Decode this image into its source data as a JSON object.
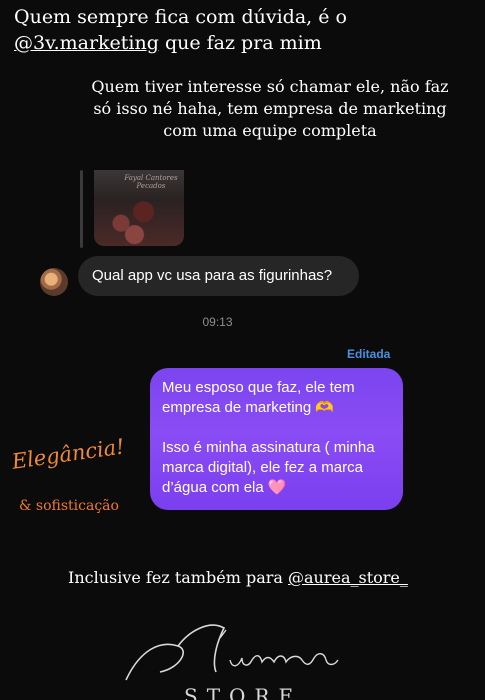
{
  "captions": {
    "line1_before": "Quem sempre fica com dúvida, é o",
    "mention1": "@3v.marketing",
    "line2_after": " que faz pra mim",
    "paragraph": "Quem tiver interesse só chamar ele, não faz só isso né haha, tem empresa de marketing com uma equipe completa",
    "bottom_before": "Inclusive fez também para ",
    "mention2": "@aurea_store_"
  },
  "reply_thumbnail": {
    "overlay_text": "Fayal Cantores Pecados"
  },
  "incoming": {
    "text": "Qual app vc usa para as figurinhas?"
  },
  "timestamp": "09:13",
  "edited_label": "Editada",
  "outgoing": {
    "paragraph1": "Meu esposo que faz, ele tem empresa de marketing 🫶",
    "paragraph2": "Isso é minha assinatura ( minha marca digital), ele fez a marca d’água com ela 🩷"
  },
  "stickers": {
    "elegancia": "Elegância!",
    "sofisticacao": "& sofisticação"
  },
  "logo": {
    "script": "Aurea",
    "store": "STORE"
  },
  "colors": {
    "background": "#0b0b0b",
    "incoming_bubble": "#262626",
    "outgoing_bubble": "#8a4cf4",
    "edited": "#4a90e2",
    "sticker_orange": "#f08a3a"
  }
}
